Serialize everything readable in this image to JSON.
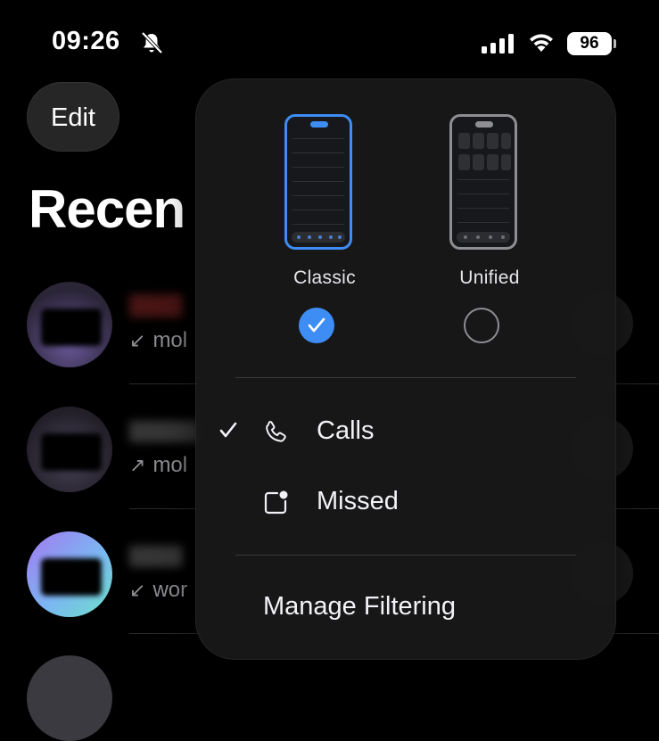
{
  "status_bar": {
    "time": "09:26",
    "battery": "96"
  },
  "background": {
    "edit_label": "Edit",
    "title": "Recen",
    "rows": [
      {
        "subtitle": "mol",
        "direction": "incoming"
      },
      {
        "subtitle": "mol",
        "direction": "outgoing"
      },
      {
        "subtitle": "wor",
        "direction": "incoming"
      }
    ]
  },
  "menu": {
    "layouts": [
      {
        "label": "Classic",
        "selected": true
      },
      {
        "label": "Unified",
        "selected": false
      }
    ],
    "items": [
      {
        "label": "Calls",
        "checked": true,
        "icon": "phone-icon"
      },
      {
        "label": "Missed",
        "checked": false,
        "icon": "missed-badge-icon"
      }
    ],
    "manage_label": "Manage Filtering"
  },
  "colors": {
    "accent": "#3d8df5",
    "menu_bg": "#18181a",
    "text": "#f2f2f7",
    "secondary": "#8e8e93"
  }
}
